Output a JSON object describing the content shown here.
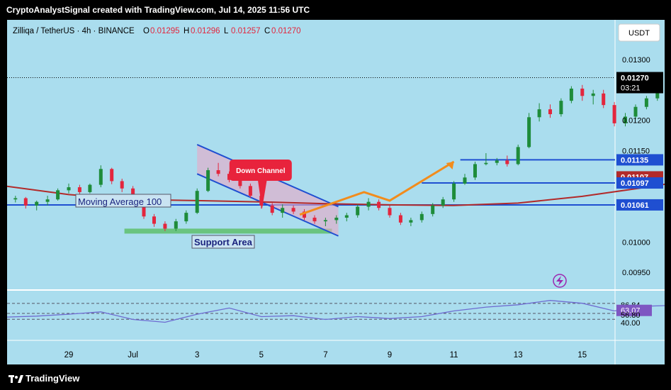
{
  "header": {
    "caption": "CryptoAnalystSignal created with TradingView.com, Jul 14, 2025 11:56 UTC"
  },
  "footer": {
    "brand": "TradingView"
  },
  "colors": {
    "background": "#aaddee",
    "bull": "#1e8c3a",
    "bear": "#e3263d",
    "ma": "#b22a2a",
    "level_line": "#1f4fd1",
    "arrow": "#f28c1c",
    "rsi": "#6e6bd1",
    "price_tag": "#000000",
    "level_tag": "#1f4fd1",
    "ma_tag": "#b22a2a",
    "rsi_tag": "#7e57c2"
  },
  "chart_data": {
    "type": "candlestick",
    "legend": {
      "symbol": "Zilliqa / TetherUS · 4h · BINANCE",
      "o_label": "O",
      "o": "0.01295",
      "h_label": "H",
      "h": "0.01296",
      "l_label": "L",
      "l": "0.01257",
      "c_label": "C",
      "c": "0.01270"
    },
    "currency": "USDT",
    "ylim": [
      0.0092,
      0.0133
    ],
    "y_ticks": [
      "0.01300",
      "0.01200",
      "0.01150",
      "0.01000",
      "0.00950"
    ],
    "x_ticks": [
      "29",
      "Jul",
      "3",
      "5",
      "7",
      "9",
      "11",
      "13",
      "15"
    ],
    "current_price": "0.01270",
    "countdown": "03:21",
    "levels": [
      {
        "value": 0.01135,
        "label": "0.01135",
        "x_start_day": 7.1
      },
      {
        "value": 0.01097,
        "label": "0.01097",
        "x_start_day": 6.5
      },
      {
        "value": 0.01061,
        "label": "0.01061",
        "x_start_day": 0
      }
    ],
    "ma_last": "0.01107",
    "annotations": {
      "down_channel": "Down Channel",
      "moving_average": "Moving Average 100",
      "support": "Support Area"
    },
    "candles": [
      [
        28.0,
        0.01075,
        0.0108,
        0.01068,
        0.0107
      ],
      [
        28.17,
        0.0107,
        0.01076,
        0.01065,
        0.01072
      ],
      [
        28.33,
        0.01072,
        0.01074,
        0.01055,
        0.0106
      ],
      [
        28.5,
        0.0106,
        0.01068,
        0.01052,
        0.01066
      ],
      [
        28.67,
        0.01066,
        0.01076,
        0.0106,
        0.0107
      ],
      [
        28.83,
        0.0107,
        0.01088,
        0.01068,
        0.01085
      ],
      [
        29.0,
        0.01085,
        0.01096,
        0.0108,
        0.0109
      ],
      [
        29.17,
        0.0109,
        0.01094,
        0.01078,
        0.01082
      ],
      [
        29.33,
        0.01082,
        0.01096,
        0.0108,
        0.01094
      ],
      [
        29.5,
        0.01094,
        0.01126,
        0.0109,
        0.0112
      ],
      [
        29.67,
        0.0112,
        0.01122,
        0.01095,
        0.011
      ],
      [
        29.83,
        0.011,
        0.01104,
        0.01082,
        0.01088
      ],
      [
        30.0,
        0.01088,
        0.01092,
        0.0106,
        0.01065
      ],
      [
        30.17,
        0.01065,
        0.01068,
        0.01038,
        0.01042
      ],
      [
        30.33,
        0.01042,
        0.01046,
        0.01025,
        0.0103
      ],
      [
        30.5,
        0.0103,
        0.01034,
        0.01018,
        0.01022
      ],
      [
        30.67,
        0.01022,
        0.01038,
        0.01018,
        0.01034
      ],
      [
        30.83,
        0.01034,
        0.01052,
        0.0103,
        0.01048
      ],
      [
        31.0,
        0.01048,
        0.01088,
        0.01046,
        0.01084
      ],
      [
        31.17,
        0.01084,
        0.01122,
        0.01082,
        0.01118
      ],
      [
        31.33,
        0.01118,
        0.0113,
        0.01108,
        0.01112
      ],
      [
        31.5,
        0.01112,
        0.01116,
        0.01098,
        0.01102
      ],
      [
        31.67,
        0.01102,
        0.01106,
        0.01088,
        0.01092
      ],
      [
        31.83,
        0.01092,
        0.01096,
        0.01072,
        0.01076
      ],
      [
        32.0,
        0.01076,
        0.01082,
        0.01055,
        0.0106
      ],
      [
        32.17,
        0.0106,
        0.01064,
        0.01044,
        0.01048
      ],
      [
        32.33,
        0.01048,
        0.01062,
        0.0104,
        0.01056
      ],
      [
        32.5,
        0.01056,
        0.0106,
        0.01046,
        0.0105
      ],
      [
        32.67,
        0.0105,
        0.01054,
        0.01036,
        0.0104
      ],
      [
        32.83,
        0.0104,
        0.01044,
        0.0103,
        0.01034
      ],
      [
        33.0,
        0.01034,
        0.0104,
        0.01026,
        0.01036
      ],
      [
        33.17,
        0.01036,
        0.01044,
        0.0103,
        0.0104
      ],
      [
        33.33,
        0.0104,
        0.01048,
        0.01034,
        0.01044
      ],
      [
        33.5,
        0.01044,
        0.01062,
        0.0104,
        0.01058
      ],
      [
        33.67,
        0.01058,
        0.01072,
        0.01052,
        0.01066
      ],
      [
        33.83,
        0.01066,
        0.0107,
        0.01052,
        0.01056
      ],
      [
        34.0,
        0.01056,
        0.0106,
        0.0104,
        0.01044
      ],
      [
        34.17,
        0.01044,
        0.01048,
        0.01028,
        0.01032
      ],
      [
        34.33,
        0.01032,
        0.0104,
        0.01026,
        0.01036
      ],
      [
        34.5,
        0.01036,
        0.0105,
        0.01032,
        0.01046
      ],
      [
        34.67,
        0.01046,
        0.01064,
        0.01042,
        0.0106
      ],
      [
        34.83,
        0.0106,
        0.01074,
        0.01056,
        0.0107
      ],
      [
        35.0,
        0.0107,
        0.011,
        0.01066,
        0.01096
      ],
      [
        35.17,
        0.01096,
        0.01112,
        0.01094,
        0.01106
      ],
      [
        35.33,
        0.01106,
        0.01132,
        0.01102,
        0.01128
      ],
      [
        35.5,
        0.01128,
        0.01146,
        0.01126,
        0.0113
      ],
      [
        35.67,
        0.0113,
        0.01138,
        0.01126,
        0.01134
      ],
      [
        35.83,
        0.01134,
        0.01142,
        0.01124,
        0.01128
      ],
      [
        36.0,
        0.01128,
        0.0116,
        0.01126,
        0.01156
      ],
      [
        36.17,
        0.01156,
        0.01212,
        0.01154,
        0.01205
      ],
      [
        36.33,
        0.01205,
        0.01228,
        0.01198,
        0.01218
      ],
      [
        36.5,
        0.01218,
        0.01226,
        0.01204,
        0.0121
      ],
      [
        36.67,
        0.0121,
        0.01236,
        0.01206,
        0.01232
      ],
      [
        36.83,
        0.01232,
        0.01256,
        0.01228,
        0.01252
      ],
      [
        37.0,
        0.01252,
        0.01258,
        0.01232,
        0.0124
      ],
      [
        37.17,
        0.0124,
        0.0125,
        0.01226,
        0.01244
      ],
      [
        37.33,
        0.01244,
        0.0125,
        0.0122,
        0.01225
      ],
      [
        37.5,
        0.01225,
        0.0123,
        0.0119,
        0.01195
      ],
      [
        37.67,
        0.01195,
        0.01212,
        0.0119,
        0.01206
      ],
      [
        37.83,
        0.01206,
        0.01226,
        0.01202,
        0.01222
      ],
      [
        38.0,
        0.01222,
        0.0124,
        0.01218,
        0.01236
      ],
      [
        38.17,
        0.01236,
        0.01262,
        0.01232,
        0.01256
      ],
      [
        38.33,
        0.01256,
        0.01262,
        0.0124,
        0.01246
      ],
      [
        38.5,
        0.01246,
        0.01282,
        0.01242,
        0.01278
      ],
      [
        38.67,
        0.01278,
        0.01284,
        0.0125,
        0.0126
      ],
      [
        38.83,
        0.0126,
        0.01276,
        0.01256,
        0.0127
      ],
      [
        39.0,
        0.0127,
        0.01296,
        0.01256,
        0.01288
      ],
      [
        39.17,
        0.01288,
        0.01308,
        0.0128,
        0.01295
      ],
      [
        39.33,
        0.01295,
        0.01296,
        0.01257,
        0.0127
      ]
    ],
    "ma100": [
      [
        28.0,
        0.01092
      ],
      [
        29.0,
        0.01078
      ],
      [
        30.0,
        0.0107
      ],
      [
        31.0,
        0.01068
      ],
      [
        32.0,
        0.01066
      ],
      [
        33.0,
        0.01063
      ],
      [
        34.0,
        0.01061
      ],
      [
        35.0,
        0.0106
      ],
      [
        36.0,
        0.01064
      ],
      [
        37.0,
        0.01075
      ],
      [
        38.0,
        0.0109
      ],
      [
        39.0,
        0.01107
      ]
    ],
    "rsi": {
      "ticks": [
        "86.84",
        "63.07",
        "56.80",
        "40.00"
      ],
      "current": "63.07",
      "values": [
        [
          28.0,
          49
        ],
        [
          28.5,
          51
        ],
        [
          29.0,
          55
        ],
        [
          29.5,
          60
        ],
        [
          30.0,
          44
        ],
        [
          30.5,
          38
        ],
        [
          31.0,
          55
        ],
        [
          31.5,
          68
        ],
        [
          32.0,
          50
        ],
        [
          32.5,
          52
        ],
        [
          33.0,
          44
        ],
        [
          33.5,
          50
        ],
        [
          34.0,
          46
        ],
        [
          34.5,
          50
        ],
        [
          35.0,
          62
        ],
        [
          35.5,
          70
        ],
        [
          36.0,
          75
        ],
        [
          36.5,
          84
        ],
        [
          37.0,
          78
        ],
        [
          37.5,
          62
        ],
        [
          38.0,
          72
        ],
        [
          38.5,
          74
        ],
        [
          39.0,
          72
        ],
        [
          39.33,
          63
        ]
      ]
    }
  }
}
